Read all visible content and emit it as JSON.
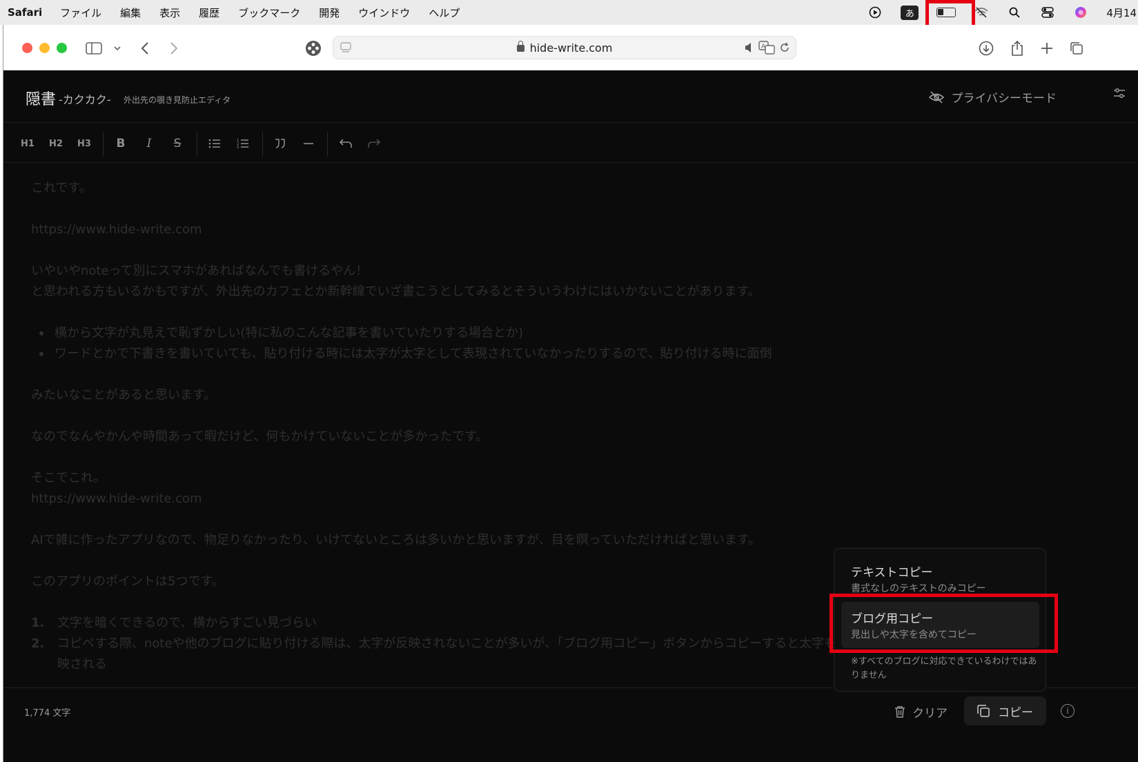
{
  "menubar": {
    "app": "Safari",
    "menus": [
      "ファイル",
      "編集",
      "表示",
      "履歴",
      "ブックマーク",
      "開発",
      "ウインドウ",
      "ヘルプ"
    ],
    "ime": "あ",
    "clock": "4月14"
  },
  "browser": {
    "url": "hide-write.com"
  },
  "app": {
    "title_main": "隠書",
    "title_sub": "-カクカク-",
    "title_tag": "外出先の覗き見防止エディタ",
    "privacy_mode": "プライバシーモード",
    "format_buttons": {
      "h1": "H1",
      "h2": "H2",
      "h3": "H3",
      "bold": "B",
      "italic": "I",
      "strike": "S"
    },
    "editor": {
      "p1": "これです。",
      "p2": "https://www.hide-write.com",
      "p3a": "いやいやnoteって別にスマホがあればなんでも書けるやん！",
      "p3b": "と思われる方もいるかもですが、外出先のカフェとか新幹線でいざ書こうとしてみるとそういうわけにはいかないことがあります。",
      "bullets": [
        "横から文字が丸見えで恥ずかしい(特に私のこんな記事を書いていたりする場合とか)",
        "ワードとかで下書きを書いていても、貼り付ける時には太字が太字として表現されていなかったりするので、貼り付ける時に面倒"
      ],
      "p4": "みたいなことがあると思います。",
      "p5": "なのでなんやかんや時間あって暇だけど、何もかけていないことが多かったです。",
      "p6a": "そこでこれ。",
      "p6b": "https://www.hide-write.com",
      "p7": "AIで雑に作ったアプリなので、物足りなかったり、いけてないところは多いかと思いますが、目を瞑っていただければと思います。",
      "p8": "このアプリのポイントは5つです。",
      "numbered": [
        {
          "num": "1.",
          "text": "文字を暗くできるので、横からすごい見づらい"
        },
        {
          "num": "2.",
          "text": "コピペする際、noteや他のブログに貼り付ける際は、太字が反映されないことが多いが、「ブログ用コピー」ボタンからコピーすると太字も反映される"
        }
      ]
    },
    "footer": {
      "char_count": "1,774 文字",
      "clear": "クリア",
      "copy": "コピー"
    },
    "dropdown": {
      "item1_title": "テキストコピー",
      "item1_desc": "書式なしのテキストのみコピー",
      "item2_title": "ブログ用コピー",
      "item2_desc": "見出しや太字を含めてコピー",
      "note": "※すべてのブログに対応できているわけではありません"
    }
  },
  "highlight_color": "#e60012"
}
